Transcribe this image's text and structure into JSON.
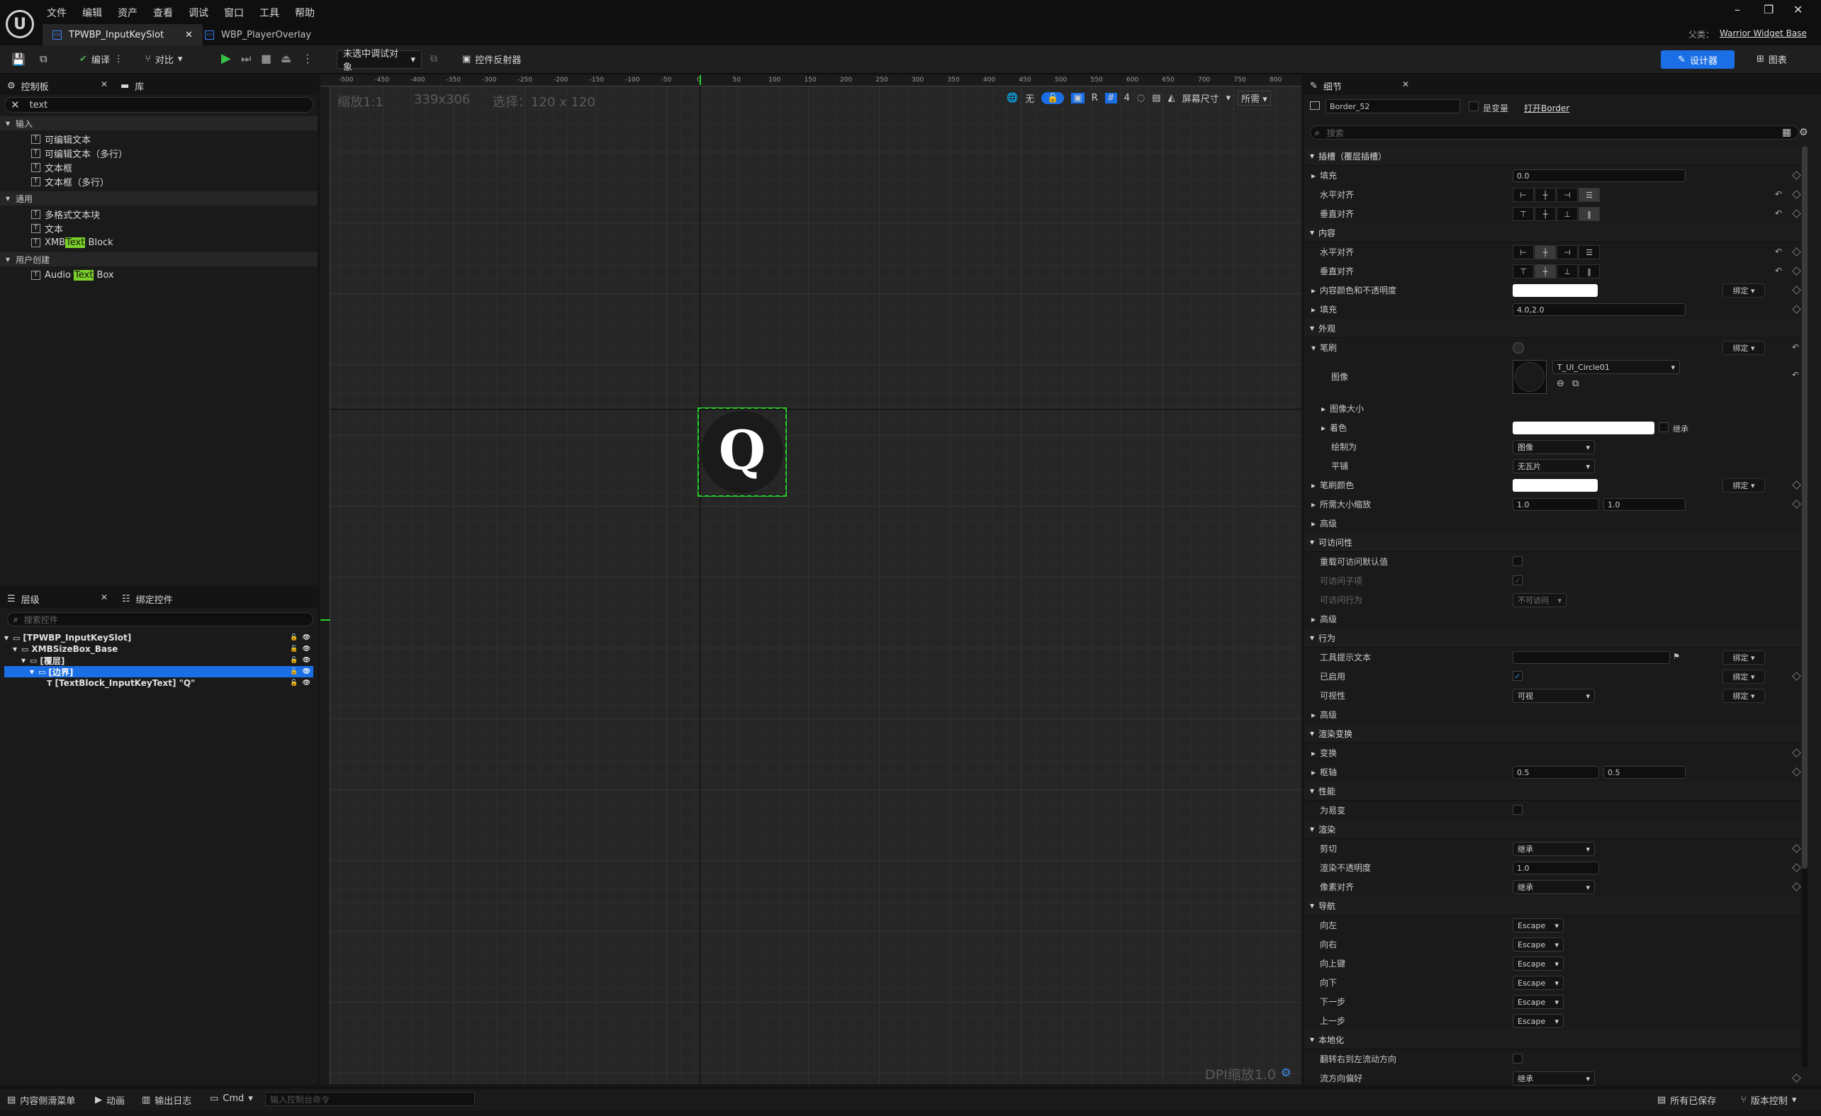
{
  "titlebar": {
    "menus": [
      "文件",
      "编辑",
      "资产",
      "查看",
      "调试",
      "窗口",
      "工具",
      "帮助"
    ],
    "tabs": [
      {
        "label": "TPWBP_InputKeySlot",
        "active": true
      },
      {
        "label": "WBP_PlayerOverlay",
        "active": false
      }
    ],
    "parent_label": "父类：",
    "parent_value": "Warrior Widget Base"
  },
  "toolbar": {
    "compile": "编译",
    "diff": "对比",
    "debug_object": "未选中调试对象",
    "widget_reflector": "控件反射器",
    "designer": "设计器",
    "graph": "图表"
  },
  "palette": {
    "tab_palette": "控制板",
    "tab_library": "库",
    "search_value": "text",
    "categories": [
      {
        "name": "输入",
        "items": [
          {
            "label": "可编辑文本"
          },
          {
            "label": "可编辑文本（多行）"
          },
          {
            "label": "文本框"
          },
          {
            "label": "文本框（多行）"
          }
        ]
      },
      {
        "name": "通用",
        "items": [
          {
            "label": "多格式文本块"
          },
          {
            "label": "文本"
          },
          {
            "label_pre": "XMB",
            "label_hl": "Text",
            "label_post": " Block"
          }
        ]
      },
      {
        "name": "用户创建",
        "items": [
          {
            "label_pre": "Audio ",
            "label_hl": "Text",
            "label_post": " Box"
          }
        ]
      }
    ]
  },
  "hierarchy": {
    "tab_hierarchy": "层级",
    "tab_bind": "绑定控件",
    "search_placeholder": "搜索控件",
    "nodes": [
      {
        "label": "[TPWBP_InputKeySlot]",
        "depth": 0,
        "selected": false
      },
      {
        "label": "XMBSizeBox_Base",
        "depth": 1,
        "selected": false
      },
      {
        "label": "[覆层]",
        "depth": 2,
        "selected": false
      },
      {
        "label": "[边界]",
        "depth": 3,
        "selected": true
      },
      {
        "label": "[TextBlock_InputKeyText] \"Q\"",
        "depth": 4,
        "selected": false
      }
    ]
  },
  "canvas": {
    "zoom": "缩放1:1",
    "size": "339x306",
    "selection": "选择：120 x 120",
    "dpi": "DPI缩放1.0",
    "ruler": [
      "-500",
      "-450",
      "-400",
      "-350",
      "-300",
      "-250",
      "-200",
      "-150",
      "-100",
      "-50",
      "0",
      "50",
      "100",
      "150",
      "200",
      "250",
      "300",
      "350",
      "400",
      "450",
      "500",
      "550",
      "600",
      "650",
      "700",
      "750",
      "800"
    ],
    "toolbar_none": "无",
    "toolbar_r": "R",
    "toolbar_grid": "4",
    "screen_size": "屏幕尺寸",
    "fill_mode": "所需",
    "widget_letter": "Q"
  },
  "details": {
    "tab": "细节",
    "name_value": "Border_52",
    "is_variable": "是变量",
    "open_link": "打开Border",
    "search_placeholder": "搜索",
    "rows": {
      "slot_cat": "插槽（覆层插槽）",
      "padding": "填充",
      "padding_value": "0.0",
      "halign": "水平对齐",
      "valign": "垂直对齐",
      "content_cat": "内容",
      "content_halign": "水平对齐",
      "content_valign": "垂直对齐",
      "content_color": "内容颜色和不透明度",
      "content_padding": "填充",
      "content_padding_value": "4.0,2.0",
      "appearance_cat": "外观",
      "brush": "笔刷",
      "image": "图像",
      "image_asset": "T_UI_Circle01",
      "image_size": "图像大小",
      "tint": "着色",
      "inherit": "继承",
      "draw_as": "绘制为",
      "draw_as_value": "图像",
      "tiling": "平铺",
      "tiling_value": "无瓦片",
      "brush_color": "笔刷颜色",
      "desired_scale": "所需大小缩放",
      "scale_x": "1.0",
      "scale_y": "1.0",
      "advanced1": "高级",
      "accessibility_cat": "可访问性",
      "override_access": "重载可访问默认值",
      "access_children": "可访问子项",
      "access_behavior": "可访问行为",
      "access_behavior_value": "不可访问",
      "advanced2": "高级",
      "behavior_cat": "行为",
      "tooltip": "工具提示文本",
      "enabled": "已启用",
      "visibility": "可视性",
      "visibility_value": "可视",
      "advanced3": "高级",
      "render_transform_cat": "渲染变换",
      "transform": "变换",
      "pivot": "枢轴",
      "pivot_x": "0.5",
      "pivot_y": "0.5",
      "performance_cat": "性能",
      "volatile": "为易变",
      "rendering_cat": "渲染",
      "clipping": "剪切",
      "clipping_value": "继承",
      "render_opacity": "渲染不透明度",
      "render_opacity_value": "1.0",
      "pixel_snapping": "像素对齐",
      "pixel_snapping_value": "继承",
      "navigation_cat": "导航",
      "nav_left": "向左",
      "nav_right": "向右",
      "nav_up": "向上键",
      "nav_down": "向下",
      "nav_next": "下一步",
      "nav_prev": "上一步",
      "nav_value": "Escape",
      "localization_cat": "本地化",
      "flip_rtl": "翻转右到左流动方向",
      "flow_pref": "流方向偏好",
      "flow_pref_value": "继承",
      "bind": "绑定"
    }
  },
  "statusbar": {
    "content_drawer": "内容侧滑菜单",
    "animation": "动画",
    "output_log": "输出日志",
    "cmd": "Cmd",
    "console_placeholder": "输入控制台命令",
    "all_saved": "所有已保存",
    "source_control": "版本控制"
  },
  "colors": {
    "accent_blue": "#1a6ee6",
    "selection_green": "#25d02a",
    "highlight_green": "#7bd12a"
  }
}
